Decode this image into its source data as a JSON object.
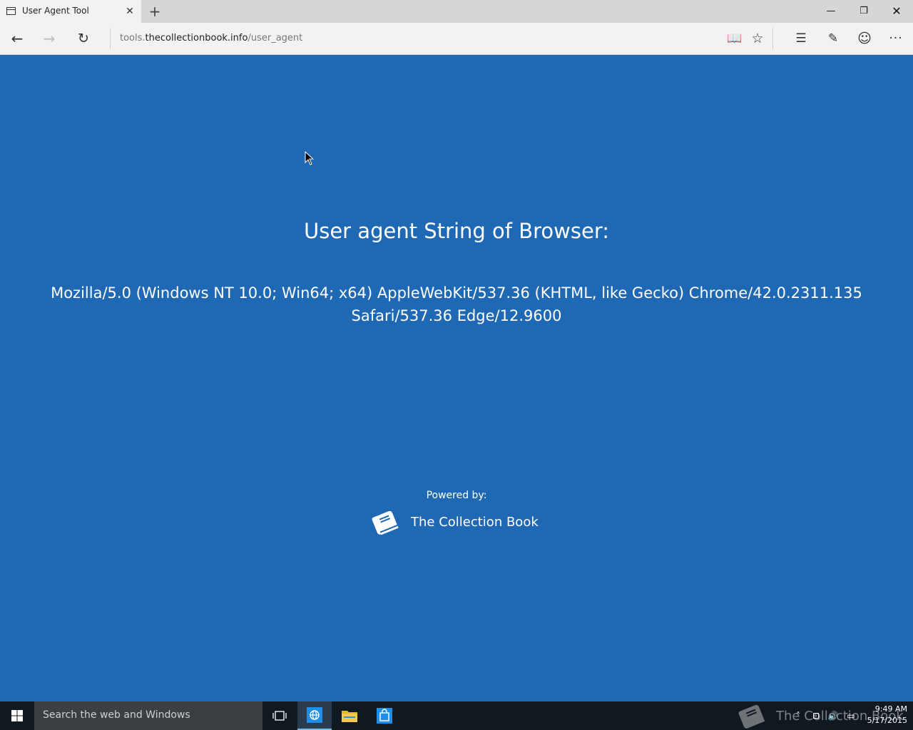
{
  "window": {
    "tab_title": "User Agent Tool",
    "tab_close": "✕",
    "new_tab": "+",
    "minimize": "—",
    "maximize": "❐",
    "close": "✕"
  },
  "nav": {
    "back": "←",
    "forward": "→",
    "refresh": "↻",
    "url_prefix": "tools.",
    "url_domain": "thecollectionbook.info",
    "url_path": "/user_agent",
    "reading_view": "📖",
    "favorite": "☆",
    "hub": "☰",
    "web_note": "✎",
    "feedback": "☺",
    "more": "···"
  },
  "page": {
    "heading": "User agent String of Browser:",
    "user_agent": "Mozilla/5.0 (Windows NT 10.0; Win64; x64) AppleWebKit/537.36 (KHTML, like Gecko) Chrome/42.0.2311.135 Safari/537.36 Edge/12.9600",
    "powered_by_label": "Powered by:",
    "brand_name": "The Collection Book"
  },
  "taskbar": {
    "search_placeholder": "Search the web and Windows",
    "watermark": "The Collection Book",
    "tray_chevron": "˄",
    "tray_network": "⊡",
    "tray_volume": "🔊",
    "tray_action": "▭",
    "time": "9:49 AM",
    "date": "5/17/2015"
  },
  "colors": {
    "page_background": "#1f68b4",
    "chrome_background": "#f2f2f2",
    "titlebar_background": "#d6d6d6",
    "taskbar_background": "#101820"
  }
}
